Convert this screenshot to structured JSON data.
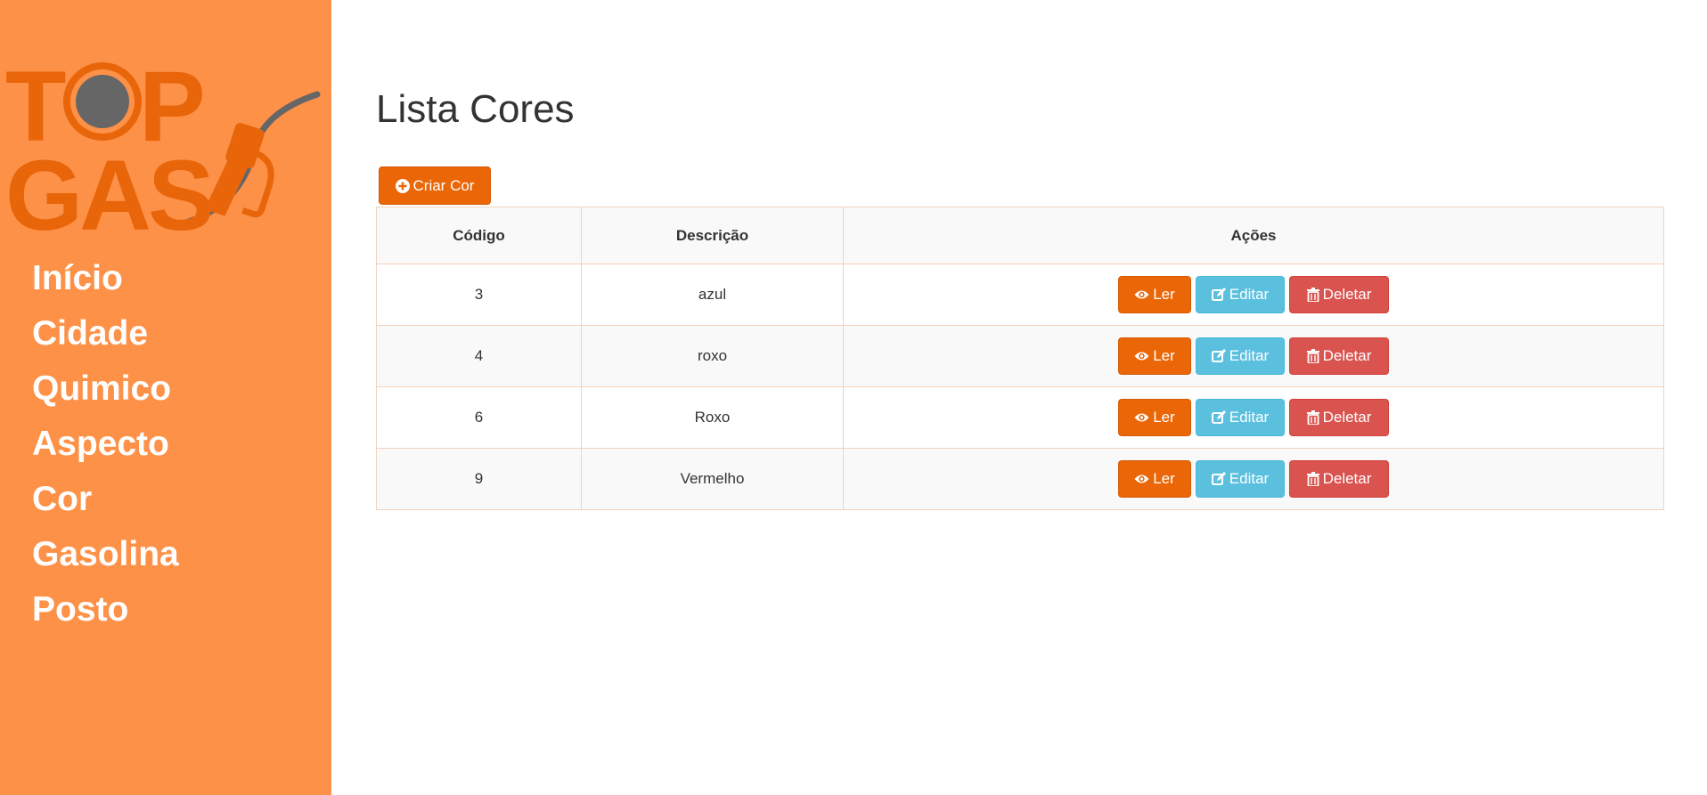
{
  "sidebar": {
    "logo": {
      "line1": "TOP",
      "line2": "GAS",
      "icon": "fuel-nozzle-icon"
    },
    "items": [
      {
        "label": "Início"
      },
      {
        "label": "Cidade"
      },
      {
        "label": "Quimico"
      },
      {
        "label": "Aspecto"
      },
      {
        "label": "Cor"
      },
      {
        "label": "Gasolina"
      },
      {
        "label": "Posto"
      }
    ]
  },
  "main": {
    "title": "Lista Cores",
    "create_button": {
      "label": "Criar Cor",
      "icon": "plus-circle-icon"
    },
    "table": {
      "headers": [
        "Código",
        "Descrição",
        "Ações"
      ],
      "rows": [
        {
          "codigo": "3",
          "descricao": "azul"
        },
        {
          "codigo": "4",
          "descricao": "roxo"
        },
        {
          "codigo": "6",
          "descricao": "Roxo"
        },
        {
          "codigo": "9",
          "descricao": "Vermelho"
        }
      ],
      "actions": {
        "read": {
          "label": "Ler",
          "icon": "eye-icon"
        },
        "edit": {
          "label": "Editar",
          "icon": "edit-icon"
        },
        "delete": {
          "label": "Deletar",
          "icon": "trash-icon"
        }
      }
    }
  },
  "colors": {
    "sidebar_bg": "#fe9148",
    "primary": "#ea6607",
    "info": "#5bc0de",
    "danger": "#d9534f",
    "logo_gray": "#666666"
  }
}
